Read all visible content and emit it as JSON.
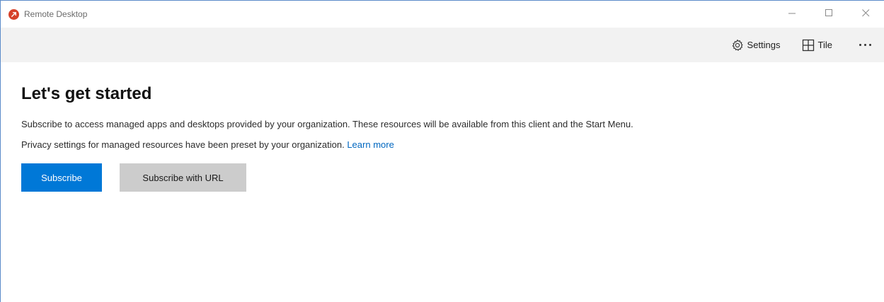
{
  "window": {
    "title": "Remote Desktop",
    "controls": {
      "minimize": "minimize-icon",
      "maximize": "maximize-icon",
      "close": "close-icon"
    }
  },
  "toolbar": {
    "settings_label": "Settings",
    "tile_label": "Tile",
    "more": "more-icon"
  },
  "main": {
    "heading": "Let's get started",
    "description": "Subscribe to access managed apps and desktops provided by your organization. These resources will be available from this client and the Start Menu.",
    "privacy_text": "Privacy settings for managed resources have been preset by your organization.",
    "learn_more": "Learn more",
    "subscribe_label": "Subscribe",
    "subscribe_url_label": "Subscribe with URL"
  },
  "colors": {
    "accent": "#0078d7",
    "link": "#0067c0",
    "app_icon": "#d64129",
    "toolbar_bg": "#f2f2f2",
    "secondary_button": "#cccccc"
  }
}
